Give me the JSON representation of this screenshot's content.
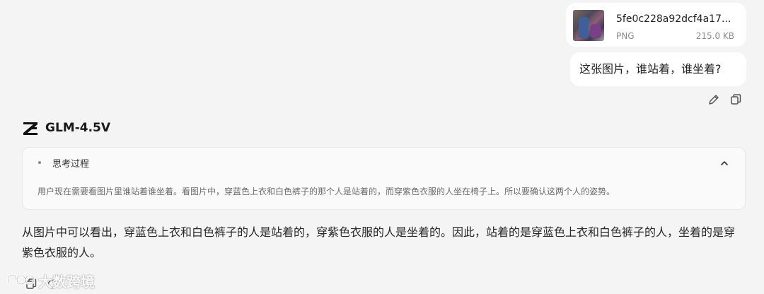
{
  "attachment": {
    "file_name": "5fe0c228a92dcf4a17...",
    "file_type": "PNG",
    "file_size": "215.0 KB"
  },
  "user_message": {
    "text": "这张图片，谁站着，谁坐着?"
  },
  "user_actions": {
    "edit_icon": "pencil-icon",
    "copy_icon": "copy-icon"
  },
  "model": {
    "name": "GLM-4.5V",
    "logo_icon": "z-logo-icon"
  },
  "thinking": {
    "title": "思考过程",
    "content": "用户现在需要看图片里谁站着谁坐着。看图片中，穿蓝色上衣和白色裤子的那个人是站着的，而穿紫色衣服的人坐在椅子上。所以要确认这两个人的姿势。",
    "collapse_icon": "chevron-up-icon"
  },
  "response": {
    "text": "从图片中可以看出，穿蓝色上衣和白色裤子的人是站着的，穿紫色衣服的人是坐着的。因此，站着的是穿蓝色上衣和白色裤子的人，坐着的是穿紫色衣服的人。"
  },
  "response_actions": {
    "copy_icon": "copy-icon",
    "regenerate_icon": "refresh-icon"
  },
  "watermark": {
    "text": "大数跨境"
  }
}
